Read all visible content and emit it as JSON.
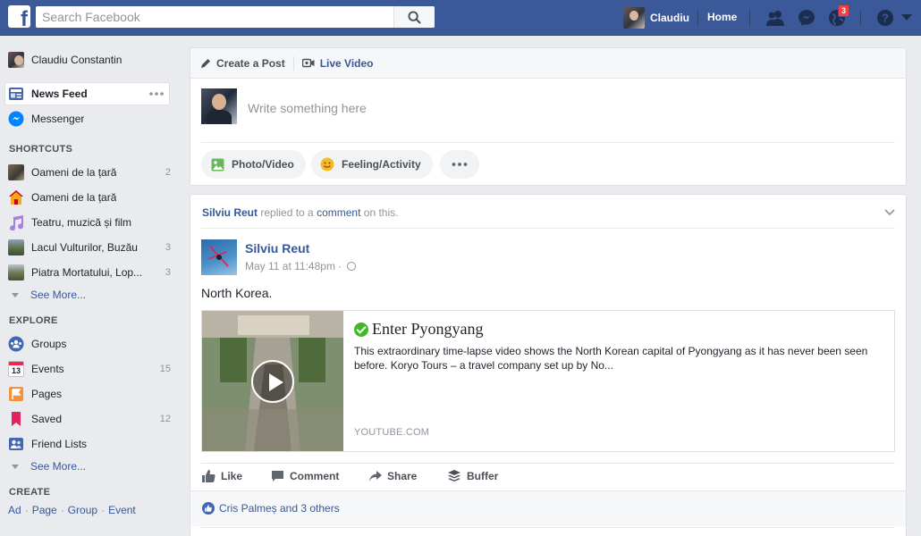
{
  "topbar": {
    "logo_letter": "f",
    "search_placeholder": "Search Facebook",
    "user_name": "Claudiu",
    "home_label": "Home",
    "notification_count": "3",
    "colors": {
      "bar": "#3b5998",
      "badge": "#fa3e3e"
    }
  },
  "sidebar": {
    "profile_name": "Claudiu Constantin",
    "news_feed": "News Feed",
    "messenger": "Messenger",
    "shortcuts_heading": "SHORTCUTS",
    "shortcuts": [
      {
        "label": "Oameni de la țară",
        "count": "2"
      },
      {
        "label": "Oameni de la țară",
        "count": ""
      },
      {
        "label": "Teatru, muzică și film",
        "count": ""
      },
      {
        "label": "Lacul Vulturilor, Buzău",
        "count": "3"
      },
      {
        "label": "Piatra Mortatului, Lop...",
        "count": "3"
      }
    ],
    "see_more": "See More...",
    "explore_heading": "EXPLORE",
    "explore": [
      {
        "label": "Groups",
        "count": "",
        "icon": "groups-icon"
      },
      {
        "label": "Events",
        "count": "15",
        "icon": "calendar-icon",
        "icon_text": "13"
      },
      {
        "label": "Pages",
        "count": "",
        "icon": "flag-icon"
      },
      {
        "label": "Saved",
        "count": "12",
        "icon": "bookmark-icon"
      },
      {
        "label": "Friend Lists",
        "count": "",
        "icon": "friend-list-icon"
      }
    ],
    "see_more_2": "See More...",
    "create_heading": "CREATE",
    "create_links": [
      "Ad",
      "Page",
      "Group",
      "Event"
    ]
  },
  "composer": {
    "tab_create": "Create a Post",
    "tab_live": "Live Video",
    "placeholder": "Write something here",
    "photo_video": "Photo/Video",
    "feeling": "Feeling/Activity"
  },
  "post": {
    "story_actor": "Silviu Reut",
    "story_text": "replied to a",
    "story_link": "comment",
    "story_tail": "on this.",
    "author": "Silviu Reut",
    "timestamp": "May 11 at 11:48pm ·",
    "text": "North Korea.",
    "link": {
      "title": "Enter Pyongyang",
      "description": "This extraordinary time-lapse video shows the North Korean capital of Pyongyang as it has never been seen before. Koryo Tours – a travel company set up by No...",
      "domain": "YOUTUBE.COM"
    },
    "actions": {
      "like": "Like",
      "comment": "Comment",
      "share": "Share",
      "buffer": "Buffer"
    },
    "likes_text": "Cris Palmeș and 3 others"
  }
}
